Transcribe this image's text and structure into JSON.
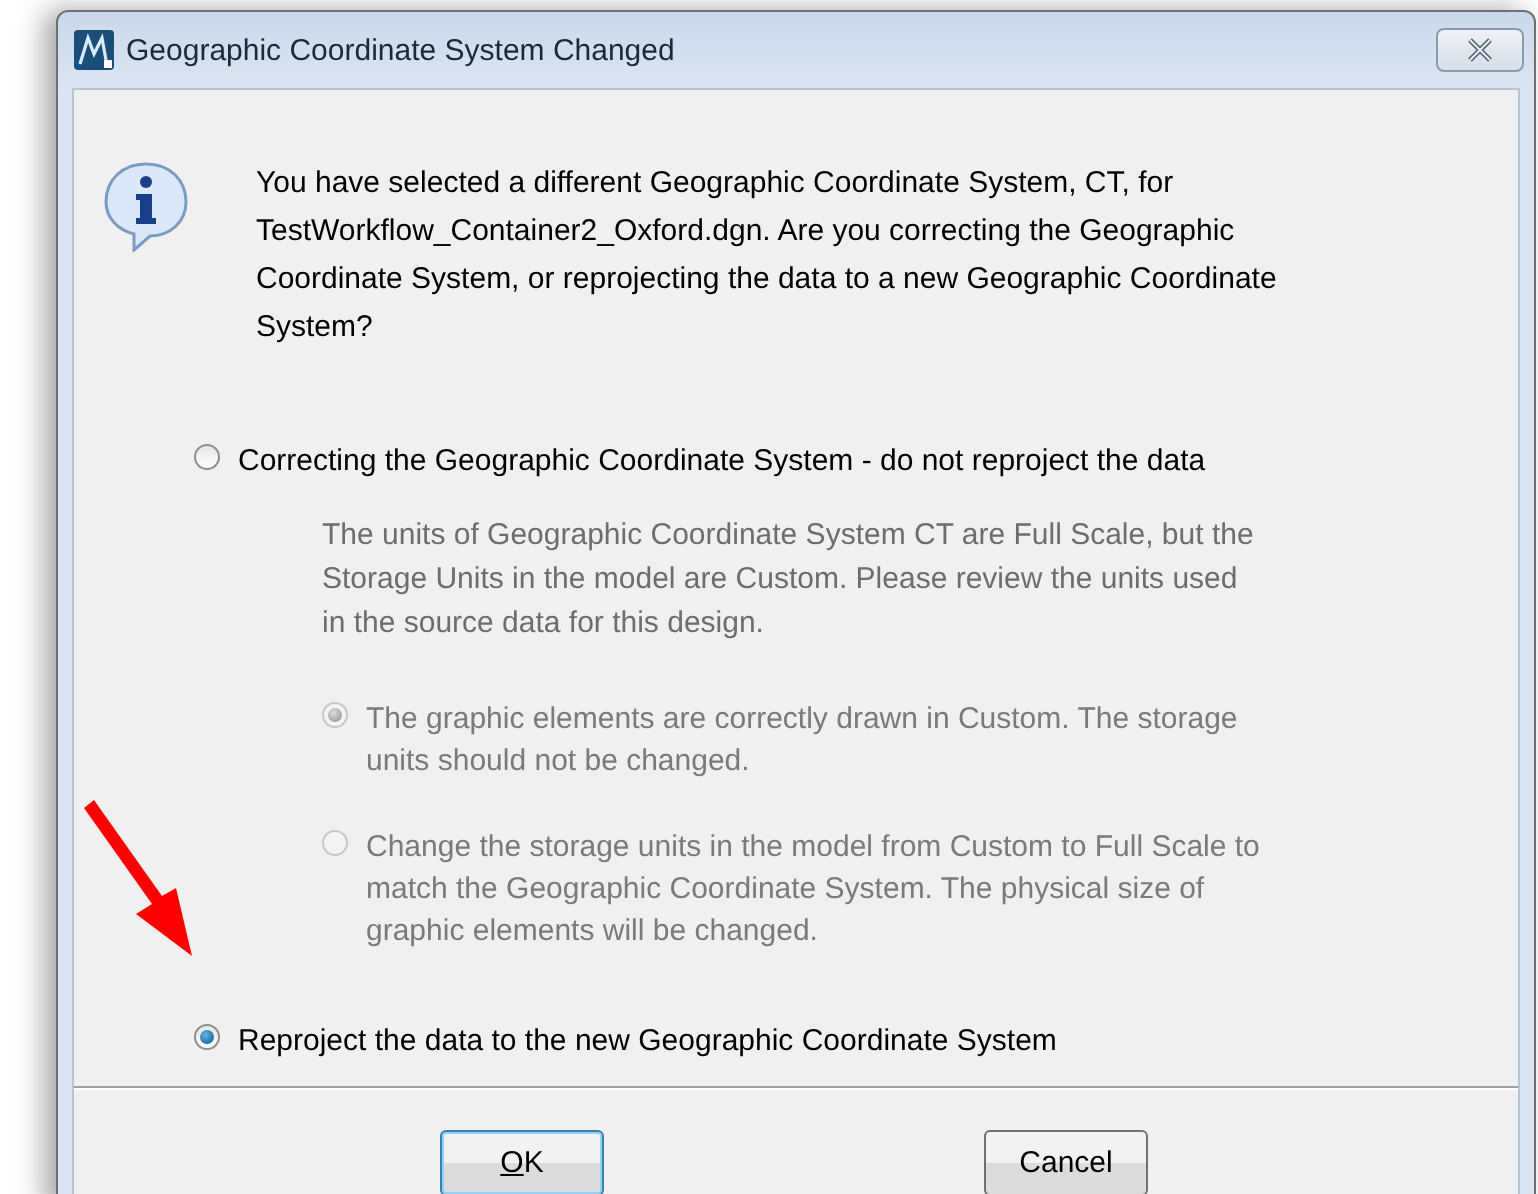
{
  "window": {
    "title": "Geographic Coordinate System Changed"
  },
  "message": "You have selected a different Geographic Coordinate System, CT, for TestWorkflow_Container2_Oxford.dgn. Are you correcting the Geographic Coordinate System, or reprojecting the data to a new Geographic Coordinate System?",
  "options": [
    {
      "label": "Correcting the Geographic Coordinate System - do not reproject the data",
      "selected": false,
      "disabled": false,
      "note": "The units of Geographic Coordinate System CT are Full Scale, but the Storage Units in the model are Custom. Please review the units used in the source data for this design.",
      "children": [
        {
          "label": "The graphic elements are correctly drawn in Custom. The storage units should not be changed.",
          "selected": true,
          "disabled": true
        },
        {
          "label": "Change the storage units in the model from Custom to Full Scale to match the Geographic Coordinate System. The physical size of graphic elements will be changed.",
          "selected": false,
          "disabled": true
        }
      ]
    },
    {
      "label": "Reproject the data to the new Geographic Coordinate System",
      "selected": true,
      "disabled": false
    }
  ],
  "buttons": [
    {
      "label": "OK",
      "default": true
    },
    {
      "label": "Cancel",
      "default": false
    }
  ]
}
